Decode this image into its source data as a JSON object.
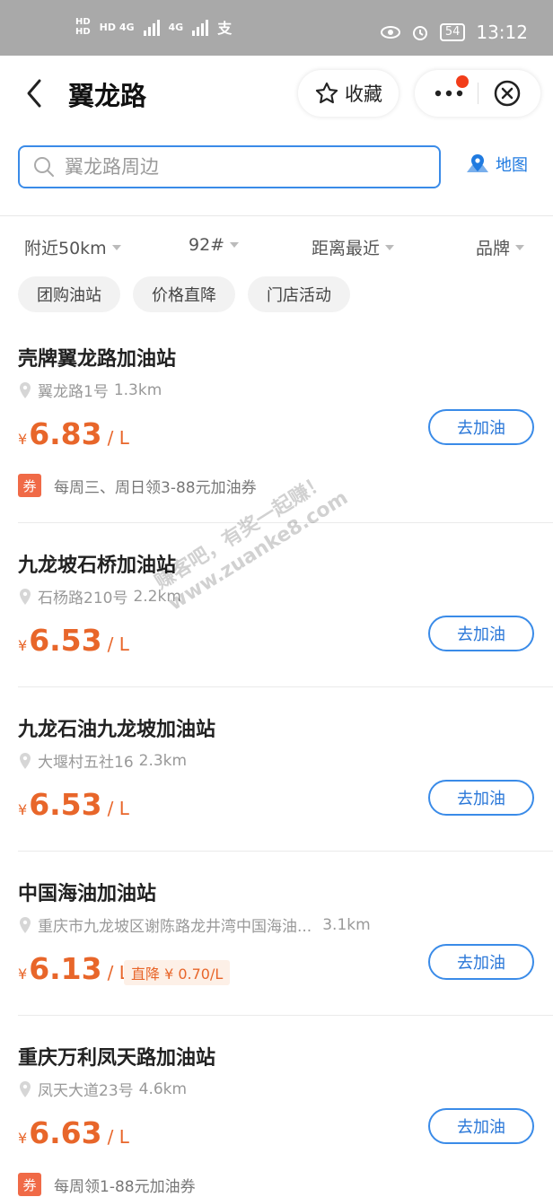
{
  "status_bar": {
    "signal_left": "HD 4G",
    "signal_right": "4G",
    "carrier_icon": "支",
    "battery": "54",
    "time": "13:12"
  },
  "navbar": {
    "title": "翼龙路",
    "favorite_label": "收藏"
  },
  "search": {
    "placeholder": "翼龙路周边",
    "map_label": "地图"
  },
  "filters": [
    {
      "label": "附近50km"
    },
    {
      "label": "92#"
    },
    {
      "label": "距离最近"
    },
    {
      "label": "品牌"
    }
  ],
  "chips": [
    {
      "label": "团购油站"
    },
    {
      "label": "价格直降"
    },
    {
      "label": "门店活动"
    }
  ],
  "stations": [
    {
      "name": "壳牌翼龙路加油站",
      "address": "翼龙路1号",
      "distance": "1.3km",
      "currency": "¥",
      "price": "6.83",
      "unit": "/ L",
      "button": "去加油",
      "coupon_badge": "券",
      "coupon_text": "每周三、周日领3-88元加油券"
    },
    {
      "name": "九龙坡石桥加油站",
      "address": "石杨路210号",
      "distance": "2.2km",
      "currency": "¥",
      "price": "6.53",
      "unit": "/ L",
      "button": "去加油"
    },
    {
      "name": "九龙石油九龙坡加油站",
      "address": "大堰村五社16",
      "distance": "2.3km",
      "currency": "¥",
      "price": "6.53",
      "unit": "/ L",
      "button": "去加油"
    },
    {
      "name": "中国海油加油站",
      "address": "重庆市九龙坡区谢陈路龙井湾中国海油...",
      "distance": "3.1km",
      "currency": "¥",
      "price": "6.13",
      "unit": "/ L",
      "drop_tag": "直降 ¥ 0.70/L",
      "button": "去加油"
    },
    {
      "name": "重庆万利凤天路加油站",
      "address": "凤天大道23号",
      "distance": "4.6km",
      "currency": "¥",
      "price": "6.63",
      "unit": "/ L",
      "button": "去加油",
      "coupon_badge": "券",
      "coupon_text": "每周领1-88元加油券"
    }
  ],
  "watermark": {
    "line1": "赚客吧，有奖一起赚！",
    "line2": "www.zuanke8.com"
  },
  "colors": {
    "accent_blue": "#3a8be8",
    "price_orange": "#e8662a",
    "coupon_red": "#f06a47",
    "notification_red": "#f23d1a"
  }
}
